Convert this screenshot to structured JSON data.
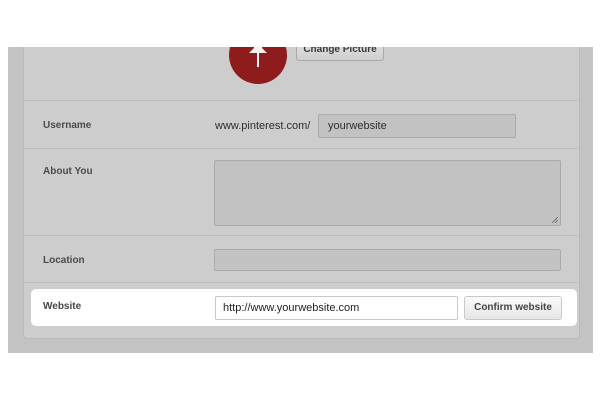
{
  "profile": {
    "change_picture_label": "Change Picture"
  },
  "fields": {
    "username_label": "Username",
    "username_prefix": "www.pinterest.com/",
    "username_value": "yourwebsite",
    "about_label": "About You",
    "about_value": "",
    "location_label": "Location",
    "location_value": "",
    "website_label": "Website",
    "website_value": "http://www.yourwebsite.com",
    "confirm_label": "Confirm website"
  },
  "colors": {
    "avatar_red": "#8f1c1c",
    "overlay_gray": "#c3c3c3"
  },
  "icons": {
    "avatar_icon": "pushpin-icon"
  }
}
